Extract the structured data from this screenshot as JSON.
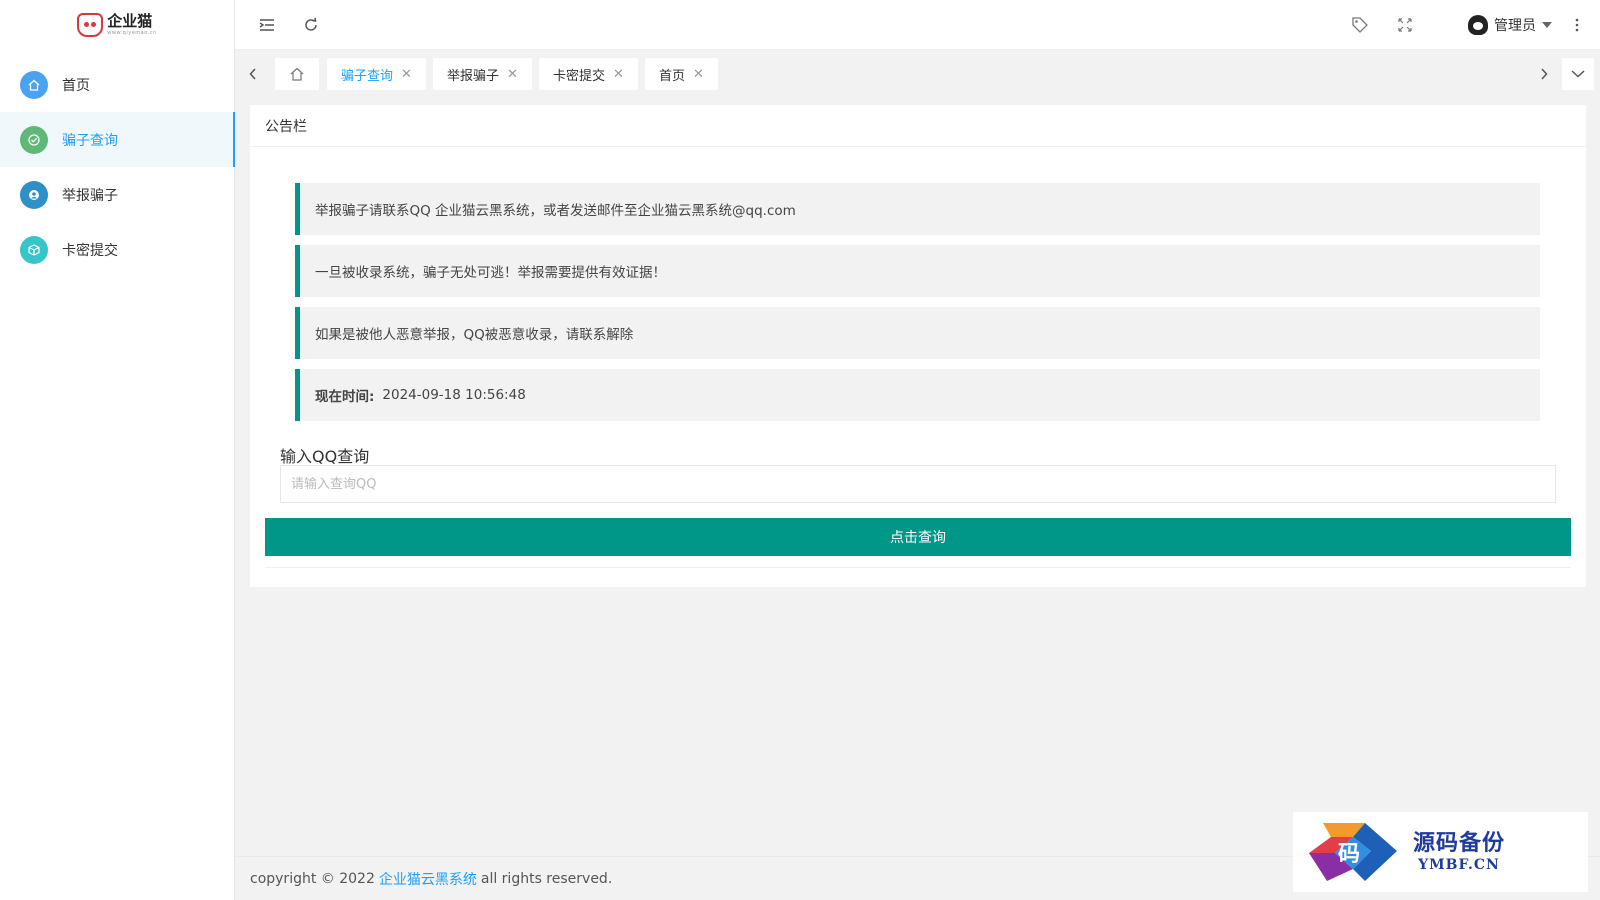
{
  "logo": {
    "name": "企业猫",
    "sub": "www.qiyemao.cn"
  },
  "sidebar": {
    "items": [
      {
        "label": "首页",
        "icon": "home-icon",
        "color": "#4aa3f0"
      },
      {
        "label": "骗子查询",
        "icon": "shield-check-icon",
        "color": "#5fb878",
        "active": true
      },
      {
        "label": "举报骗子",
        "icon": "user-icon",
        "color": "#2f8fc8"
      },
      {
        "label": "卡密提交",
        "icon": "cube-icon",
        "color": "#36c6c9"
      }
    ]
  },
  "header": {
    "user_name": "管理员"
  },
  "tabs": [
    {
      "label": "骗子查询",
      "active": true
    },
    {
      "label": "举报骗子"
    },
    {
      "label": "卡密提交"
    },
    {
      "label": "首页"
    }
  ],
  "card": {
    "title": "公告栏",
    "notices": [
      "举报骗子请联系QQ 企业猫云黑系统，或者发送邮件至企业猫云黑系统@qq.com",
      "一旦被收录系统，骗子无处可逃！举报需要提供有效证据！",
      "如果是被他人恶意举报，QQ被恶意收录，请联系解除"
    ],
    "time_label": "现在时间:",
    "time_value": "2024-09-18 10:56:48",
    "query_label": "输入QQ查询",
    "query_placeholder": "请输入查询QQ",
    "query_button": "点击查询"
  },
  "footer": {
    "prefix": "copyright © 2022",
    "link": "企业猫云黑系统",
    "suffix": "all rights reserved."
  },
  "watermark": {
    "main": "源码备份",
    "sub": "YMBF.CN",
    "glyph": "码"
  },
  "colors": {
    "accent": "#009688",
    "link": "#1e9fff"
  }
}
